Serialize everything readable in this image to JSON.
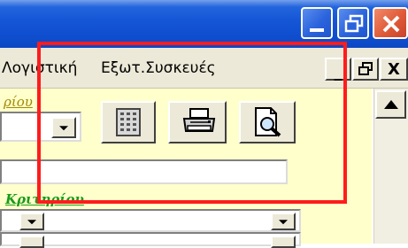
{
  "window": {
    "controls": {
      "minimize_icon": "minimize-icon",
      "restore_icon": "restore-icon",
      "close_icon": "close-icon"
    },
    "colors": {
      "titlebar": "#0b48c4",
      "close_button": "#e05a38",
      "form_background": "#ffffcc",
      "highlight_box": "#ff1c1c"
    }
  },
  "menubar": {
    "items": [
      "Λογιστική",
      "Εξωτ.Συσκευές"
    ],
    "mdi_controls": [
      "_",
      "🗗",
      "X"
    ]
  },
  "form": {
    "top_label_fragment": "ρίου",
    "criteria_label": "Κριτηρίου",
    "toolbar_buttons": [
      {
        "name": "calculator",
        "icon": "calculator-icon"
      },
      {
        "name": "print",
        "icon": "printer-icon"
      },
      {
        "name": "print-preview",
        "icon": "print-preview-icon"
      }
    ]
  }
}
